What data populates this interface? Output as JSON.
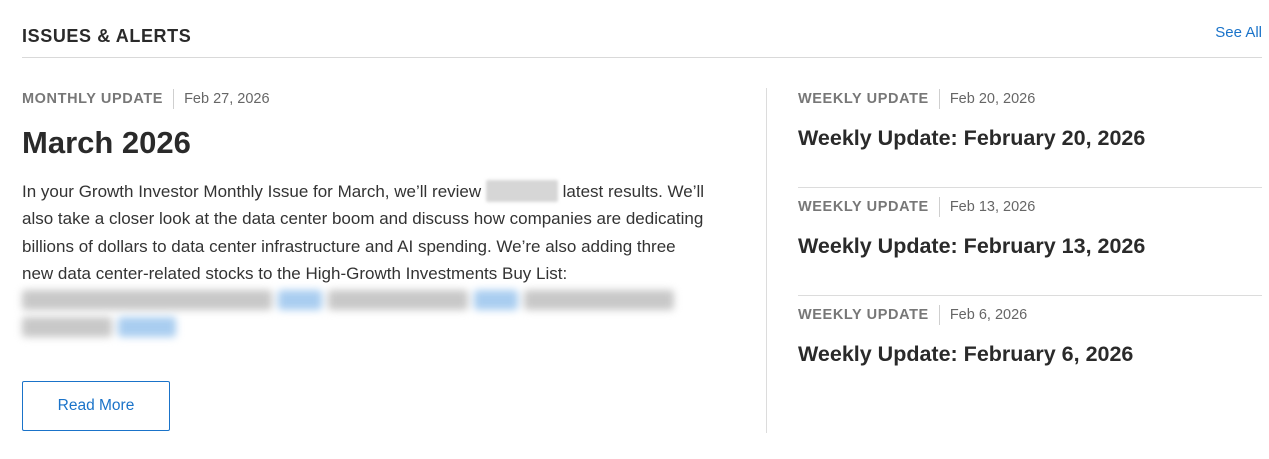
{
  "header": {
    "title": "ISSUES & ALERTS",
    "see_all_label": "See All"
  },
  "featured": {
    "type": "MONTHLY UPDATE",
    "date": "Feb 27, 2026",
    "title": "March 2026",
    "description_part1": "In your Growth Investor Monthly Issue for March, we’ll review",
    "description_part2": "latest results. We’ll also take a closer look at the data center boom and discuss how companies are dedicating billions of dollars to data center infrastructure and AI spending. We’re also adding three new data center-related stocks to the High-Growth Investments Buy List:",
    "read_more_label": "Read More"
  },
  "weekly": [
    {
      "type": "WEEKLY UPDATE",
      "date": "Feb 20, 2026",
      "title": "Weekly Update: February 20, 2026"
    },
    {
      "type": "WEEKLY UPDATE",
      "date": "Feb 13, 2026",
      "title": "Weekly Update: February 13, 2026"
    },
    {
      "type": "WEEKLY UPDATE",
      "date": "Feb 6, 2026",
      "title": "Weekly Update: February 6, 2026"
    }
  ],
  "colors": {
    "accent": "#1a73c9",
    "divider": "#dcdcdc",
    "meta_gray": "#777777"
  }
}
